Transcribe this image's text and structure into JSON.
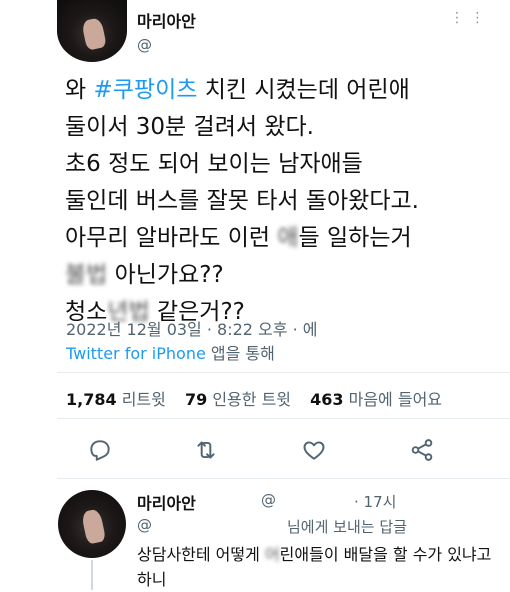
{
  "tweet": {
    "author_name": "마리아안",
    "handle": "@",
    "menu": "⋮ ⋮",
    "text_lines": [
      {
        "pre": "와 ",
        "hashtag": "#쿠팡이츠",
        "post": " 치킨 시켰는데 어린애"
      },
      {
        "pre": "둘이서 30분 걸려서 왔다.",
        "hashtag": "",
        "post": ""
      },
      {
        "pre": "초6 정도 되어 보이는 남자애들",
        "hashtag": "",
        "post": ""
      },
      {
        "pre": "둘인데 버스를 잘못 타서 돌아왔다고.",
        "hashtag": "",
        "post": ""
      },
      {
        "pre": "아무리 알바라도 이런 ",
        "blur": "애",
        "post": "들 일하는거"
      },
      {
        "pre": "",
        "blur": "불법",
        "post": " 아닌가요??"
      },
      {
        "pre": "청소",
        "blur": "년법",
        "post": " 같은거??"
      }
    ],
    "timestamp": "2022년 12월 03일 · 8:22 오후 · 에",
    "source": "Twitter for iPhone",
    "source_suffix": " 앱을 통해",
    "stats": {
      "retweets_count": "1,784",
      "retweets_label": "리트윗",
      "quotes_count": "79",
      "quotes_label": "인용한 트윗",
      "likes_count": "463",
      "likes_label": "마음에 들어요"
    },
    "actions": [
      "reply-icon",
      "retweet-icon",
      "like-icon",
      "share-icon"
    ]
  },
  "reply": {
    "author_name": "마리아안",
    "handle": "@",
    "time": "· 17시",
    "at": "@",
    "replying_to": "님에게 보내는 답글",
    "text_pre": "상담사한테 어떻게 ",
    "text_blur": "어",
    "text_post": "린애들이 배달을 할 수가 있냐고 하니"
  },
  "colors": {
    "link": "#1d9bf0",
    "secondary": "#536471",
    "divider": "#e6ecf0"
  }
}
